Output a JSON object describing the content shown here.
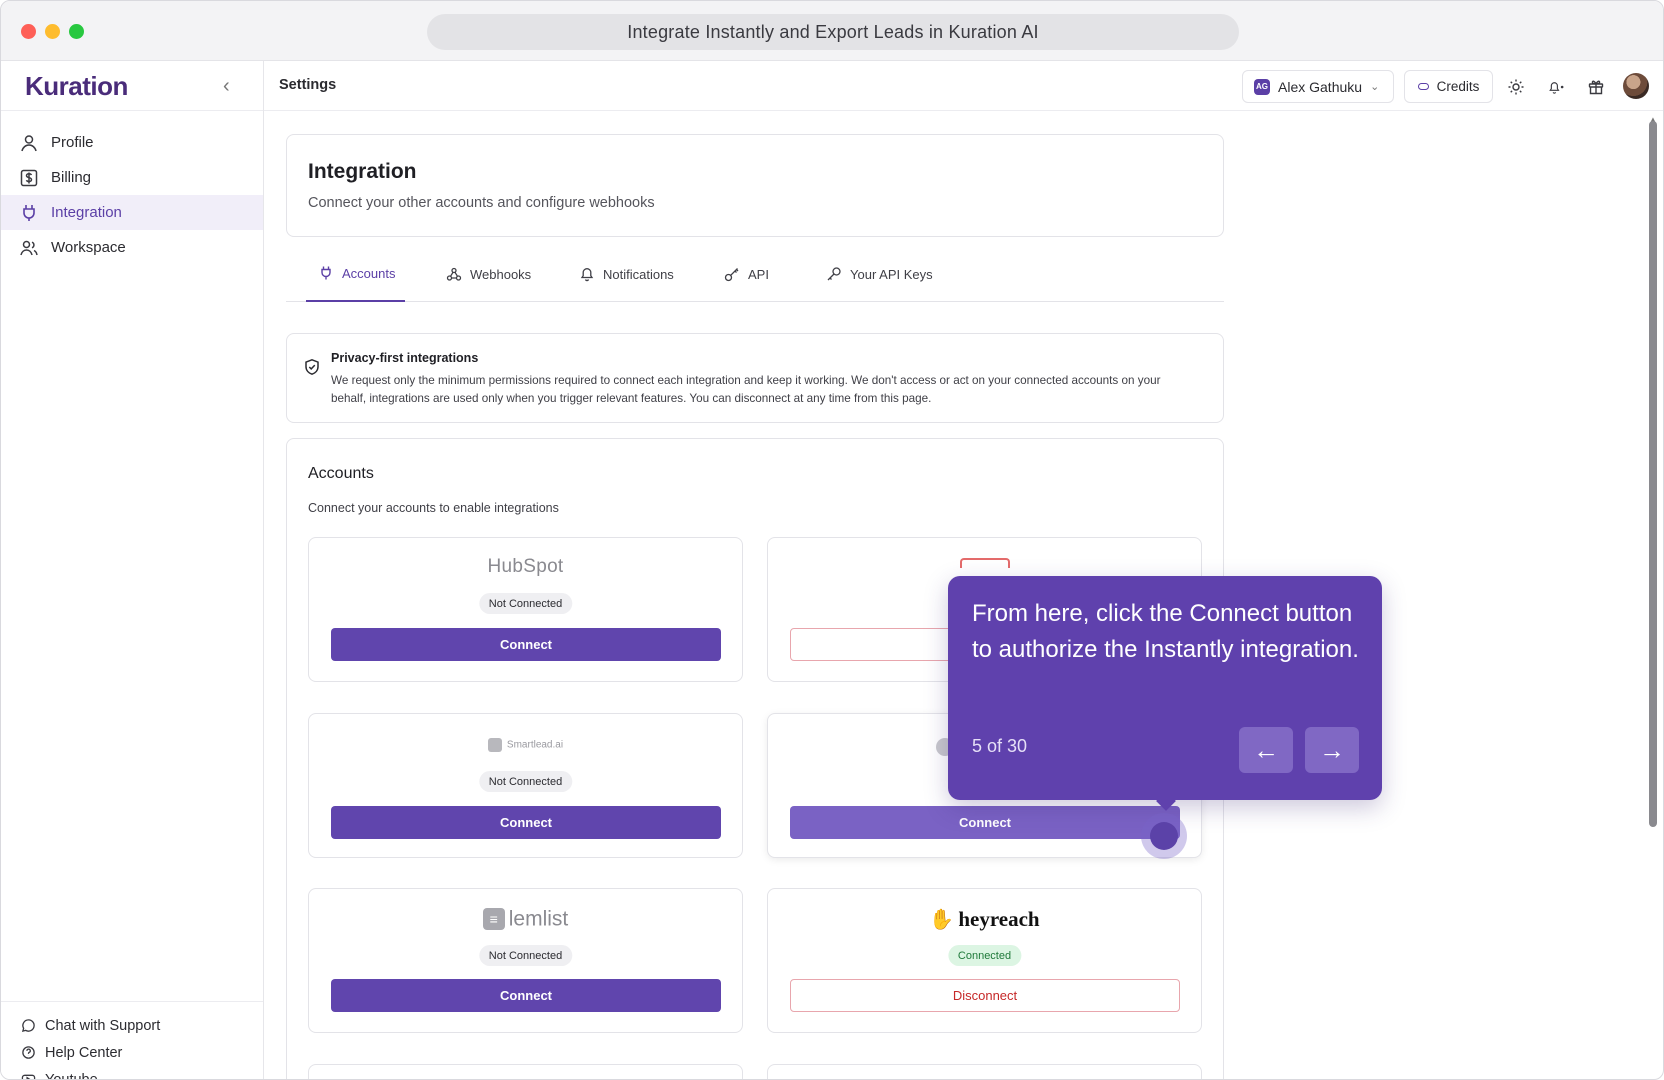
{
  "window": {
    "title": "Integrate Instantly and Export Leads in Kuration AI"
  },
  "sidebar": {
    "logo": "Kuration",
    "items": [
      {
        "label": "Profile",
        "icon": "user-icon"
      },
      {
        "label": "Billing",
        "icon": "dollar-icon"
      },
      {
        "label": "Integration",
        "icon": "plug-icon",
        "active": true
      },
      {
        "label": "Workspace",
        "icon": "users-icon"
      }
    ],
    "footer": [
      {
        "label": "Chat with Support",
        "icon": "chat-icon"
      },
      {
        "label": "Help Center",
        "icon": "help-icon"
      },
      {
        "label": "Youtube",
        "icon": "youtube-icon"
      }
    ]
  },
  "header": {
    "title": "Settings",
    "user_initials": "AG",
    "user_name": "Alex Gathuku",
    "credits_label": "Credits"
  },
  "integration": {
    "title": "Integration",
    "subtitle": "Connect your other accounts and configure webhooks"
  },
  "tabs": [
    {
      "label": "Accounts",
      "icon": "plug-icon",
      "active": true
    },
    {
      "label": "Webhooks",
      "icon": "webhook-icon"
    },
    {
      "label": "Notifications",
      "icon": "bell-icon"
    },
    {
      "label": "API",
      "icon": "key-icon"
    },
    {
      "label": "Your API Keys",
      "icon": "key-icon"
    }
  ],
  "privacy": {
    "title": "Privacy-first integrations",
    "text": "We request only the minimum permissions required to connect each integration and keep it working. We don't access or act on your connected accounts on your behalf, integrations are used only when you trigger relevant features. You can disconnect at any time from this page."
  },
  "accounts": {
    "title": "Accounts",
    "subtitle": "Connect your accounts to enable integrations",
    "cards": [
      {
        "name": "HubSpot",
        "status": "Not Connected",
        "action": "Connect"
      },
      {
        "name": "",
        "status": "",
        "action": ""
      },
      {
        "name": "Smartlead.ai",
        "status": "Not Connected",
        "action": "Connect"
      },
      {
        "name": "",
        "status": "",
        "action": "Connect"
      },
      {
        "name": "lemlist",
        "status": "Not Connected",
        "action": "Connect"
      },
      {
        "name": "heyreach",
        "status": "Connected",
        "action": "Disconnect"
      }
    ]
  },
  "tooltip": {
    "text": "From here, click the Connect button to authorize the Instantly integration.",
    "step": "5 of 30",
    "prev": "←",
    "next": "→"
  },
  "colors": {
    "accent": "#5f41ad",
    "danger": "#c62828",
    "success": "#1f7a3a"
  }
}
